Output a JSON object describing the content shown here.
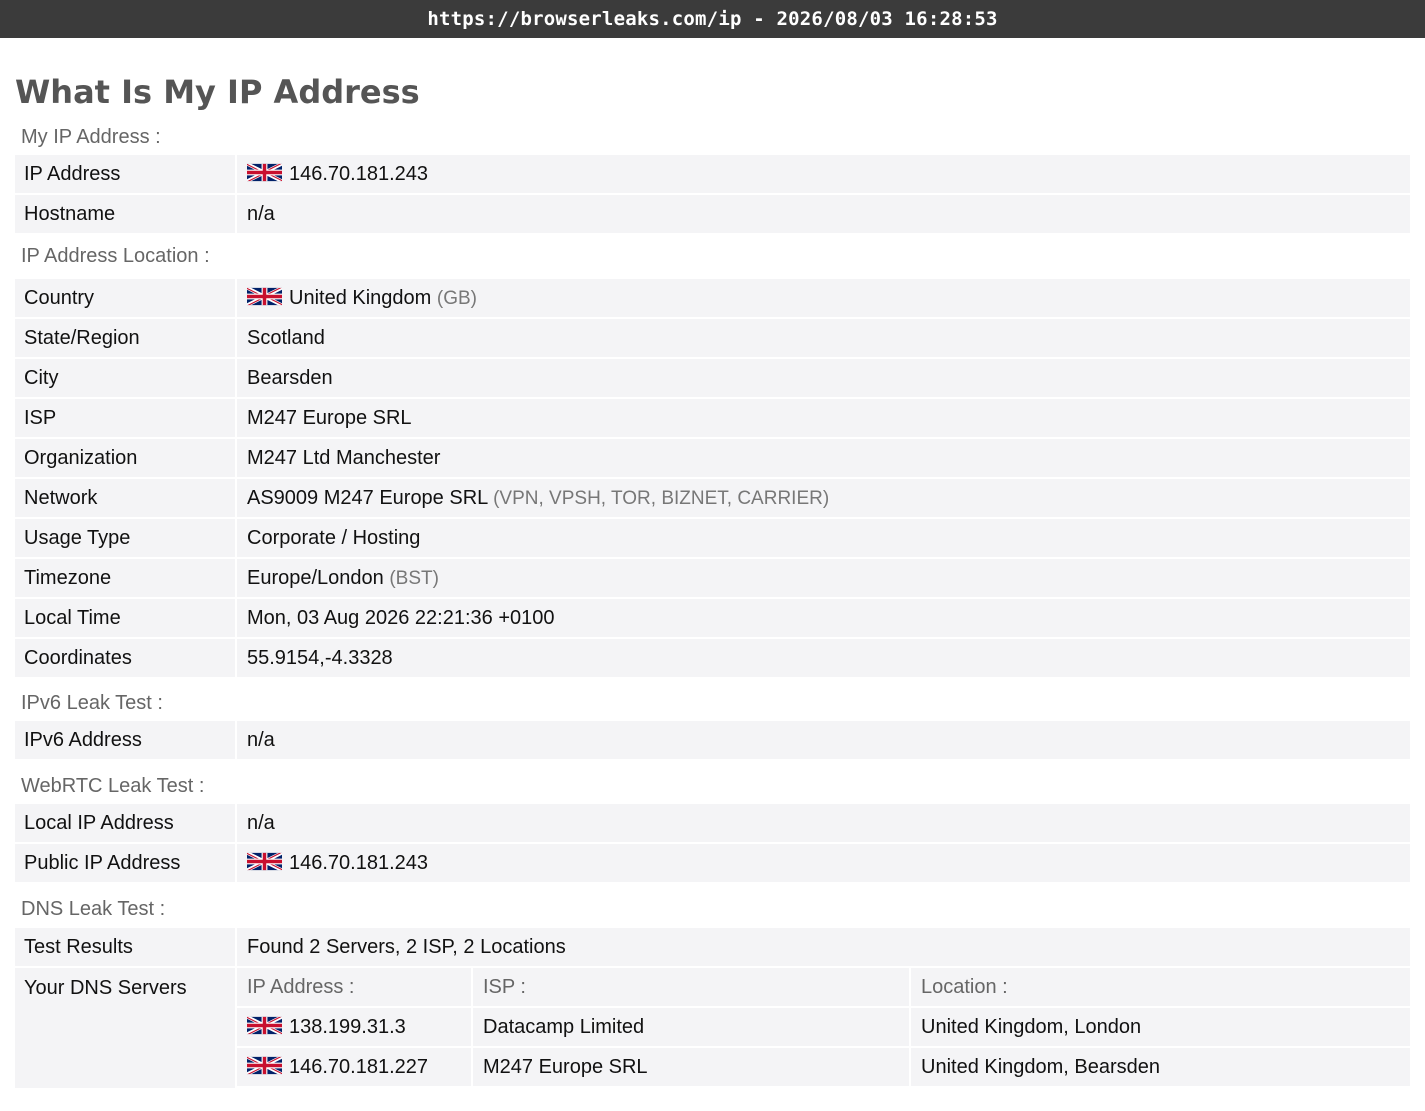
{
  "topbar": {
    "url_text": "https://browserleaks.com/ip - 2026/08/03 16:28:53"
  },
  "page": {
    "title": "What Is My IP Address"
  },
  "sections": {
    "my_ip": {
      "label": "My IP Address :",
      "ip_address": {
        "key": "IP Address",
        "value": "146.70.181.243",
        "flag": "uk-flag-icon"
      },
      "hostname": {
        "key": "Hostname",
        "value": "n/a"
      }
    },
    "location": {
      "label": "IP Address Location :",
      "country": {
        "key": "Country",
        "value": "United Kingdom",
        "extra": "(GB)",
        "flag": "uk-flag-icon"
      },
      "state": {
        "key": "State/Region",
        "value": "Scotland"
      },
      "city": {
        "key": "City",
        "value": "Bearsden"
      },
      "isp": {
        "key": "ISP",
        "value": "M247 Europe SRL"
      },
      "organization": {
        "key": "Organization",
        "value": "M247 Ltd Manchester"
      },
      "network": {
        "key": "Network",
        "value": "AS9009 M247 Europe SRL",
        "extra": "(VPN, VPSH, TOR, BIZNET, CARRIER)"
      },
      "usage_type": {
        "key": "Usage Type",
        "value": "Corporate / Hosting"
      },
      "timezone": {
        "key": "Timezone",
        "value": "Europe/London",
        "extra": "(BST)"
      },
      "local_time": {
        "key": "Local Time",
        "value": "Mon, 03 Aug 2026 22:21:36 +0100"
      },
      "coordinates": {
        "key": "Coordinates",
        "value": "55.9154,-4.3328"
      }
    },
    "ipv6": {
      "label": "IPv6 Leak Test :",
      "ipv6_address": {
        "key": "IPv6 Address",
        "value": "n/a"
      }
    },
    "webrtc": {
      "label": "WebRTC Leak Test :",
      "local_ip": {
        "key": "Local IP Address",
        "value": "n/a"
      },
      "public_ip": {
        "key": "Public IP Address",
        "value": "146.70.181.243",
        "flag": "uk-flag-icon"
      }
    },
    "dns": {
      "label": "DNS Leak Test :",
      "test_results": {
        "key": "Test Results",
        "value": "Found 2 Servers, 2 ISP, 2 Locations"
      },
      "servers_key": "Your DNS Servers",
      "columns": [
        "IP Address :",
        "ISP :",
        "Location :"
      ],
      "rows": [
        {
          "ip": "138.199.31.3",
          "isp": "Datacamp Limited",
          "location": "United Kingdom, London",
          "flag": "uk-flag-icon"
        },
        {
          "ip": "146.70.181.227",
          "isp": "M247 Europe SRL",
          "location": "United Kingdom, Bearsden",
          "flag": "uk-flag-icon"
        }
      ]
    }
  },
  "colors": {
    "topbar_bg": "#3b3b3b",
    "row_bg": "#f4f4f6",
    "label_gray": "#666666",
    "title_gray": "#555555"
  }
}
